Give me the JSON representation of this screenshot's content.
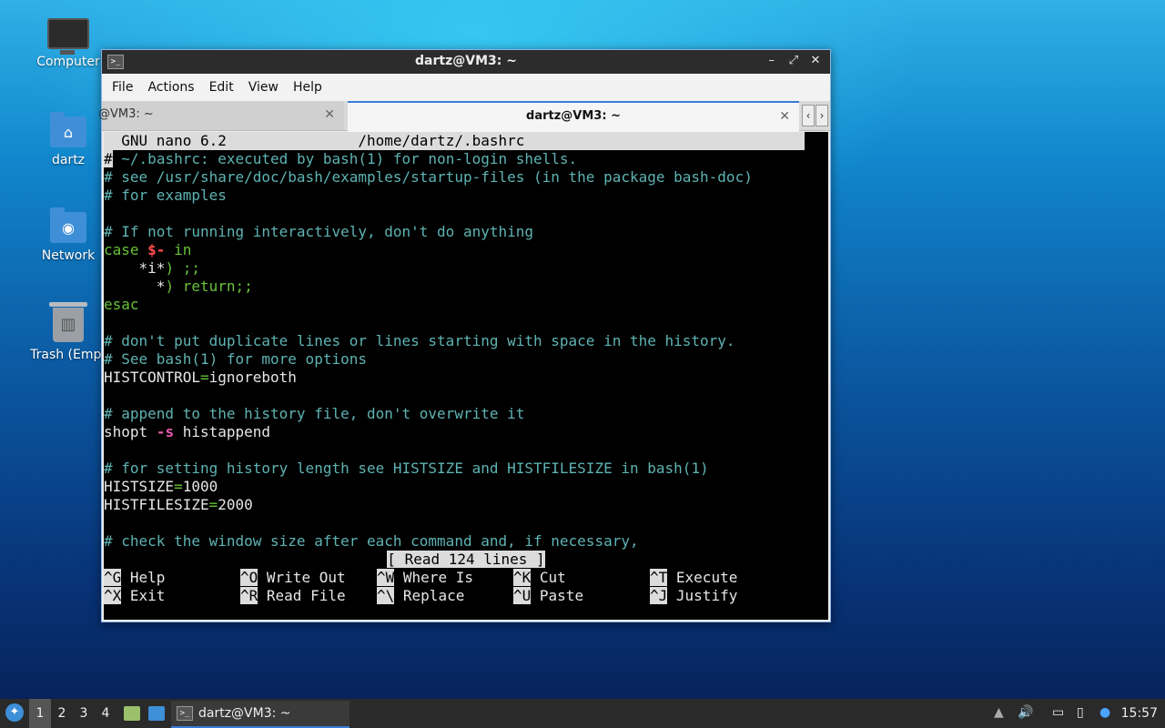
{
  "desktop": {
    "icons": [
      {
        "label": "Computer"
      },
      {
        "label": "dartz"
      },
      {
        "label": "Network"
      },
      {
        "label": "Trash (Empt"
      }
    ]
  },
  "window": {
    "title": "dartz@VM3: ~",
    "menu": [
      "File",
      "Actions",
      "Edit",
      "View",
      "Help"
    ],
    "tabs": [
      {
        "label": "@VM3: ~",
        "active": false
      },
      {
        "label": "dartz@VM3: ~",
        "active": true
      }
    ]
  },
  "nano": {
    "header_app": "GNU nano 6.2",
    "header_file": "/home/dartz/.bashrc",
    "lines": {
      "l1": "~/.bashrc: executed by bash(1) for non-login shells.",
      "l2": "# see /usr/share/doc/bash/examples/startup-files (in the package bash-doc)",
      "l3": "# for examples",
      "l5": "# If not running interactively, don't do anything",
      "l6_kw": "case",
      "l6_var": "$-",
      "l6_in": "in",
      "l7_a": "    *i*",
      "l7_b": ") ;;",
      "l8_a": "      *",
      "l8_b": ") return;;",
      "l9": "esac",
      "l11": "# don't put duplicate lines or lines starting with space in the history.",
      "l12": "# See bash(1) for more options",
      "l13_name": "HISTCONTROL",
      "l13_val": "ignoreboth",
      "l15": "# append to the history file, don't overwrite it",
      "l16_cmd": "shopt",
      "l16_opt": "-s",
      "l16_arg": "histappend",
      "l18": "# for setting history length see HISTSIZE and HISTFILESIZE in bash(1)",
      "l19_name": "HISTSIZE",
      "l19_val": "1000",
      "l20_name": "HISTFILESIZE",
      "l20_val": "2000",
      "l22": "# check the window size after each command and, if necessary,"
    },
    "status": "[ Read 124 lines ]",
    "shortcuts_row1": [
      {
        "key": "^G",
        "label": "Help"
      },
      {
        "key": "^O",
        "label": "Write Out"
      },
      {
        "key": "^W",
        "label": "Where Is"
      },
      {
        "key": "^K",
        "label": "Cut"
      },
      {
        "key": "^T",
        "label": "Execute"
      }
    ],
    "shortcuts_row2": [
      {
        "key": "^X",
        "label": "Exit"
      },
      {
        "key": "^R",
        "label": "Read File"
      },
      {
        "key": "^\\",
        "label": "Replace"
      },
      {
        "key": "^U",
        "label": "Paste"
      },
      {
        "key": "^J",
        "label": "Justify"
      }
    ]
  },
  "taskbar": {
    "workspaces": [
      "1",
      "2",
      "3",
      "4"
    ],
    "task_label": "dartz@VM3: ~",
    "clock": "15:57"
  }
}
